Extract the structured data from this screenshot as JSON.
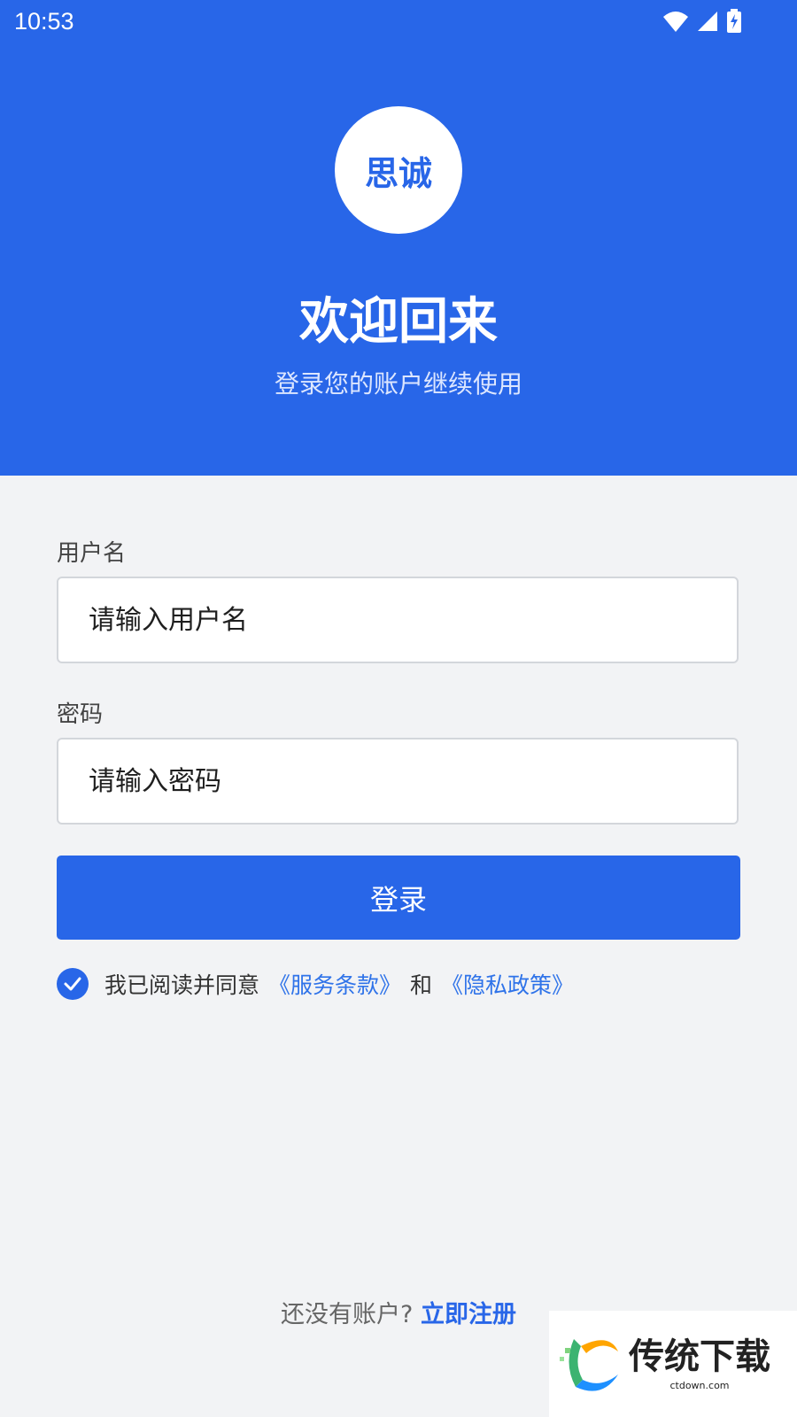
{
  "status_bar": {
    "time": "10:53"
  },
  "header": {
    "logo_text": "思诚",
    "title": "欢迎回来",
    "subtitle": "登录您的账户继续使用"
  },
  "form": {
    "username_label": "用户名",
    "username_placeholder": "请输入用户名",
    "password_label": "密码",
    "password_placeholder": "请输入密码",
    "login_button": "登录"
  },
  "agreement": {
    "checked": true,
    "prefix": "我已阅读并同意",
    "terms_link": "《服务条款》",
    "and": "和",
    "privacy_link": "《隐私政策》"
  },
  "register": {
    "prompt": "还没有账户?",
    "link": "立即注册"
  },
  "watermark": {
    "text": "传统下载",
    "url": "ctdown.com"
  },
  "colors": {
    "primary": "#2866e8",
    "background": "#f2f3f5",
    "link": "#2f73e9"
  }
}
